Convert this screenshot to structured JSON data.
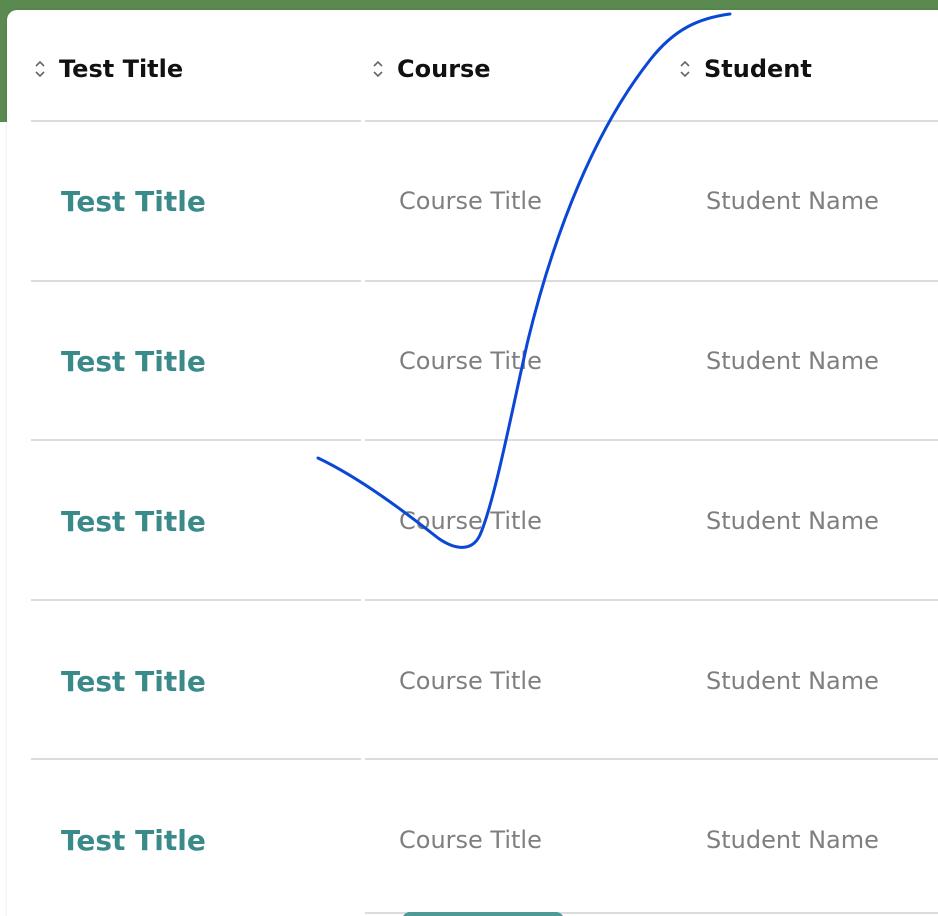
{
  "table": {
    "columns": [
      {
        "label": "Test Title",
        "sort_icon": "sort-updown-icon"
      },
      {
        "label": "Course",
        "sort_icon": "sort-updown-icon"
      },
      {
        "label": "Student",
        "sort_icon": "sort-updown-icon"
      }
    ],
    "rows": [
      {
        "test_title": "Test Title",
        "course": "Course Title",
        "student": "Student Name"
      },
      {
        "test_title": "Test Title",
        "course": "Course Title",
        "student": "Student Name"
      },
      {
        "test_title": "Test Title",
        "course": "Course Title",
        "student": "Student Name"
      },
      {
        "test_title": "Test Title",
        "course": "Course Title",
        "student": "Student Name"
      },
      {
        "test_title": "Test Title",
        "course": "Course Title",
        "student": "Student Name"
      }
    ]
  },
  "colors": {
    "banner": "#5b8a50",
    "title_link": "#3b8a8a",
    "muted_text": "#7f7f7f",
    "annotation_ink": "#0a47d6",
    "button": "#4e9a96"
  },
  "annotation": {
    "type": "checkmark-stroke"
  }
}
